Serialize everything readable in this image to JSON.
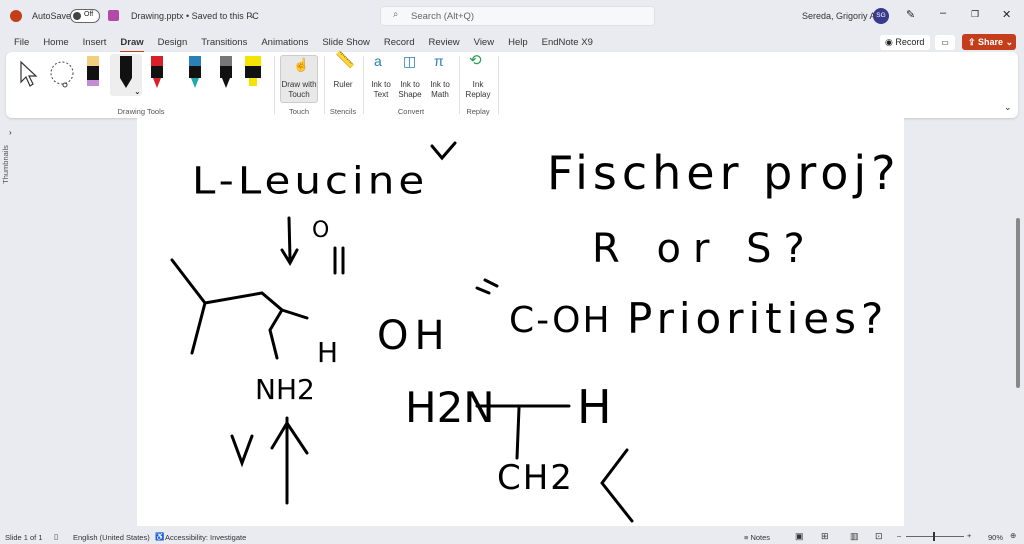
{
  "titlebar": {
    "autosave": "AutoSave",
    "autosave_state": "Off",
    "filename": "Drawing.pptx • Saved to this PC",
    "search_placeholder": "Search (Alt+Q)",
    "user": "Sereda, Grigoriy A",
    "avatar": "SG"
  },
  "tabs": [
    "File",
    "Home",
    "Insert",
    "Draw",
    "Design",
    "Transitions",
    "Animations",
    "Slide Show",
    "Record",
    "Review",
    "View",
    "Help",
    "EndNote X9"
  ],
  "active_tab": "Draw",
  "actions": {
    "record": "Record",
    "share": "Share"
  },
  "ribbon": {
    "groups": {
      "drawing_tools": "Drawing Tools",
      "touch": "Touch",
      "stencils": "Stencils",
      "convert": "Convert",
      "replay": "Replay"
    },
    "draw_with_touch": "Draw with Touch",
    "ruler": "Ruler",
    "ink_to_text": "Ink to Text",
    "ink_to_shape": "Ink to Shape",
    "ink_to_math": "Ink to Math",
    "ink_replay": "Ink Replay",
    "pen_colors": [
      "#f0d080",
      "#000000",
      "#d9202a",
      "#2a7fb8",
      "#555555",
      "#f5e400"
    ]
  },
  "thumbnails_label": "Thumbnails",
  "ink": {
    "title": "L-Leucine",
    "fischer": "Fischer proj?",
    "rors": "R or S?",
    "oh": "OH",
    "coh": "C-OH",
    "priorities": "Priorities?",
    "h1": "H",
    "h2": "H",
    "h2n": "H2N",
    "ch2": "CH2",
    "nh2": "NH2",
    "o": "O"
  },
  "status": {
    "slide": "Slide 1 of 1",
    "language": "English (United States)",
    "accessibility": "Accessibility: Investigate",
    "notes": "Notes",
    "zoom": "90%"
  }
}
